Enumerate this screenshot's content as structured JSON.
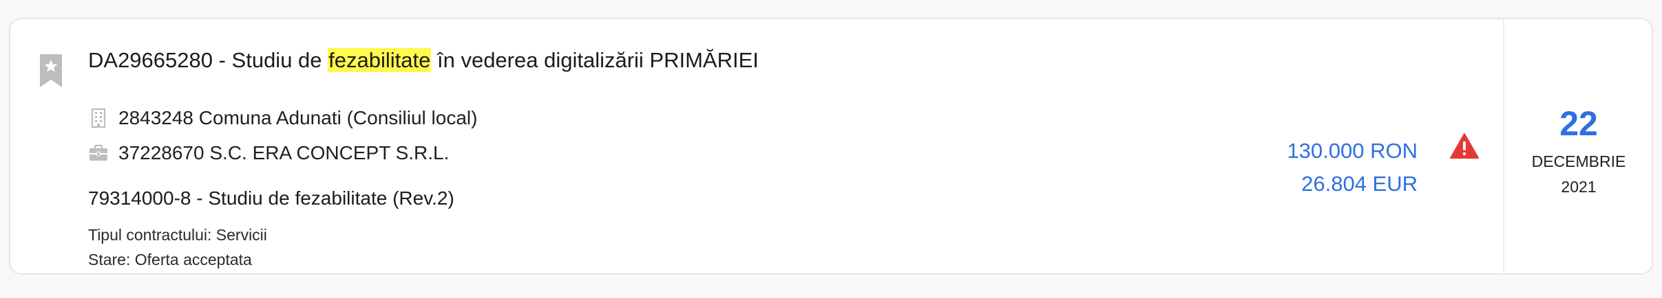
{
  "notice": {
    "title_prefix": "DA29665280 - Studiu de ",
    "title_highlight": "fezabilitate",
    "title_suffix": " în vederea digitalizării PRIMĂRIEI",
    "authority": "2843248 Comuna Adunati (Consiliul local)",
    "supplier": "37228670 S.C. ERA CONCEPT S.R.L.",
    "cpv": "79314000-8 - Studiu de fezabilitate (Rev.2)",
    "contract_type": "Tipul contractului: Servicii",
    "state_label": "Stare: ",
    "state_value": "Oferta acceptata"
  },
  "value": {
    "ron": "130.000 RON",
    "eur": "26.804 EUR"
  },
  "date": {
    "day": "22",
    "month": "DECEMBRIE",
    "year": "2021"
  },
  "icons": {
    "bookmark": "bookmark-star-icon",
    "authority": "building-icon",
    "supplier": "briefcase-icon",
    "warning": "warning-triangle-icon"
  },
  "colors": {
    "accent": "#2f6fe0",
    "highlight": "#fff94d",
    "warning": "#e53935",
    "icon_gray": "#bdbdbd"
  }
}
